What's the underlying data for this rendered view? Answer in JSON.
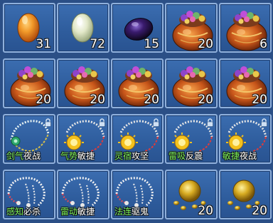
{
  "colors": {
    "panel": "#2b4f86",
    "slot": "#3565a8",
    "border": "#8fb0dc",
    "stat_green": "#7cf25a",
    "text": "#ffffff"
  },
  "rows": [
    [
      {
        "icon": "orange-egg-icon",
        "qty": "31"
      },
      {
        "icon": "pale-green-egg-icon",
        "qty": "72"
      },
      {
        "icon": "dark-purple-egg-icon",
        "qty": "15"
      },
      {
        "icon": "treasure-bag-icon",
        "qty": "20"
      },
      {
        "icon": "treasure-bag-icon",
        "qty": "6"
      }
    ],
    [
      {
        "icon": "treasure-bag-icon",
        "qty": "20"
      },
      {
        "icon": "treasure-bag-icon",
        "qty": "20"
      },
      {
        "icon": "treasure-bag-icon",
        "qty": "20"
      },
      {
        "icon": "treasure-bag-icon",
        "qty": "20"
      },
      {
        "icon": "treasure-bag-icon",
        "qty": "20"
      }
    ],
    [
      {
        "icon": "jade-necklace-icon",
        "locked": true,
        "stat1": "剑气",
        "stat2": "夜战"
      },
      {
        "icon": "sun-necklace-icon",
        "locked": true,
        "stat1": "气势",
        "stat2": "敏捷"
      },
      {
        "icon": "sun-necklace-icon",
        "locked": true,
        "stat1": "灵宿",
        "stat2": "攻坚"
      },
      {
        "icon": "sun-necklace-icon",
        "locked": true,
        "stat1": "雷吸",
        "stat2": "反震"
      },
      {
        "icon": "sun-necklace-icon",
        "locked": true,
        "stat1": "敏捷",
        "stat2": "夜战"
      }
    ],
    [
      {
        "icon": "bead-necklace-icon",
        "stat1": "感知",
        "stat2": "必杀"
      },
      {
        "icon": "bead-necklace-icon",
        "stat1": "雷动",
        "stat2": "敏捷"
      },
      {
        "icon": "bead-necklace-icon",
        "stat1": "法连",
        "stat2": "驱鬼"
      },
      {
        "icon": "golden-gourd-icon",
        "qty": "20"
      },
      {
        "icon": "golden-gourd-icon",
        "qty": "20"
      }
    ]
  ]
}
